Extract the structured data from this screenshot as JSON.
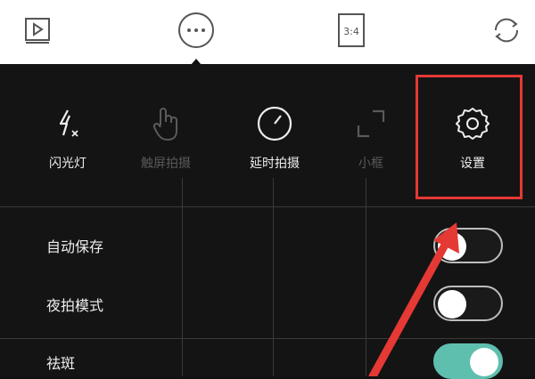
{
  "toolbar": {
    "aspect_label": "3:4",
    "icons": [
      "play-icon",
      "more-dots-icon",
      "aspect-ratio-icon",
      "switch-camera-icon"
    ]
  },
  "tools": [
    {
      "label": "闪光灯",
      "icon": "flash-off-icon",
      "enabled": true
    },
    {
      "label": "触屏拍摄",
      "icon": "touch-icon",
      "enabled": false
    },
    {
      "label": "延时拍摄",
      "icon": "timer-icon",
      "enabled": true
    },
    {
      "label": "小框",
      "icon": "frame-icon",
      "enabled": false
    },
    {
      "label": "设置",
      "icon": "gear-icon",
      "enabled": true
    }
  ],
  "settings": [
    {
      "label": "自动保存",
      "on": false
    },
    {
      "label": "夜拍模式",
      "on": false
    },
    {
      "label": "祛斑",
      "on": true
    }
  ],
  "colors": {
    "highlight": "#e53935",
    "toggle_on": "#5fbfae",
    "panel_bg": "#141414"
  }
}
